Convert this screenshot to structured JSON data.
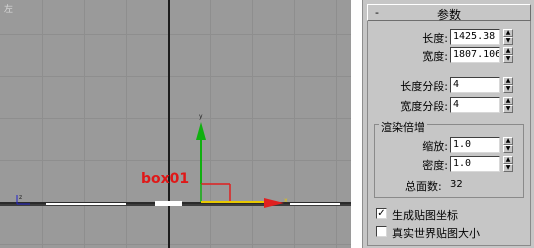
{
  "viewport": {
    "label": "左",
    "object_label": "box01",
    "colors": {
      "background": "#9a9a9a",
      "label": "#e01818",
      "x_axis": "#e02020",
      "y_axis": "#10b010"
    }
  },
  "parameters_panel": {
    "collapse_symbol": "-",
    "title": "参数",
    "length": {
      "label": "长度:",
      "value": "1425.38"
    },
    "width": {
      "label": "宽度:",
      "value": "1807.106"
    },
    "length_segments": {
      "label": "长度分段:",
      "value": "4"
    },
    "width_segments": {
      "label": "宽度分段:",
      "value": "4"
    },
    "render_multipliers": {
      "title": "渲染倍增",
      "scale": {
        "label": "缩放:",
        "value": "1.0"
      },
      "density": {
        "label": "密度:",
        "value": "1.0"
      },
      "total_faces": {
        "label": "总面数:",
        "value": "32"
      }
    },
    "generate_mapping_coords": {
      "label": "生成贴图坐标",
      "checked": true,
      "mark": "✓"
    },
    "real_world_map_size": {
      "label": "真实世界贴图大小",
      "checked": false,
      "mark": ""
    },
    "spinner_up": "▲",
    "spinner_down": "▼"
  }
}
